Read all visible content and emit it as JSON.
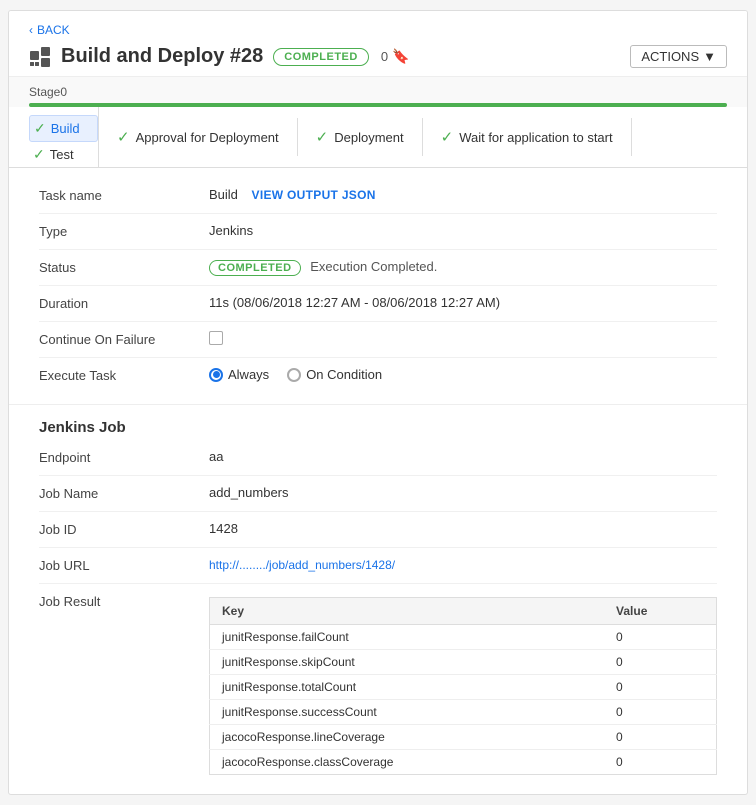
{
  "nav": {
    "back_label": "BACK"
  },
  "header": {
    "title": "Build and Deploy #28",
    "status_badge": "COMPLETED",
    "count": "0",
    "actions_label": "ACTIONS"
  },
  "stage": {
    "label": "Stage0"
  },
  "left_tabs": [
    {
      "label": "Build",
      "active": true,
      "checked": true
    },
    {
      "label": "Test",
      "active": false,
      "checked": true
    }
  ],
  "right_tabs": [
    {
      "label": "Approval for Deployment",
      "checked": true
    },
    {
      "label": "Deployment",
      "checked": true
    },
    {
      "label": "Wait for application to start",
      "checked": true
    }
  ],
  "details": {
    "task_name_label": "Task name",
    "task_name_value": "Build",
    "view_json_label": "VIEW OUTPUT JSON",
    "type_label": "Type",
    "type_value": "Jenkins",
    "status_label": "Status",
    "status_badge": "COMPLETED",
    "status_text": "Execution Completed.",
    "duration_label": "Duration",
    "duration_value": "11s (08/06/2018 12:27 AM - 08/06/2018 12:27 AM)",
    "continue_label": "Continue On Failure",
    "execute_label": "Execute Task",
    "always_label": "Always",
    "on_condition_label": "On Condition"
  },
  "jenkins": {
    "section_label": "Jenkins Job",
    "endpoint_label": "Endpoint",
    "endpoint_value": "aa",
    "job_name_label": "Job Name",
    "job_name_value": "add_numbers",
    "job_id_label": "Job ID",
    "job_id_value": "1428",
    "job_url_label": "Job URL",
    "job_url_value": "http://......../job/add_numbers/1428/",
    "job_result_label": "Job Result",
    "table_headers": [
      "Key",
      "Value"
    ],
    "table_rows": [
      {
        "key": "junitResponse.failCount",
        "value": "0"
      },
      {
        "key": "junitResponse.skipCount",
        "value": "0"
      },
      {
        "key": "junitResponse.totalCount",
        "value": "0"
      },
      {
        "key": "junitResponse.successCount",
        "value": "0"
      },
      {
        "key": "jacocoResponse.lineCoverage",
        "value": "0"
      },
      {
        "key": "jacocoResponse.classCoverage",
        "value": "0"
      }
    ]
  }
}
